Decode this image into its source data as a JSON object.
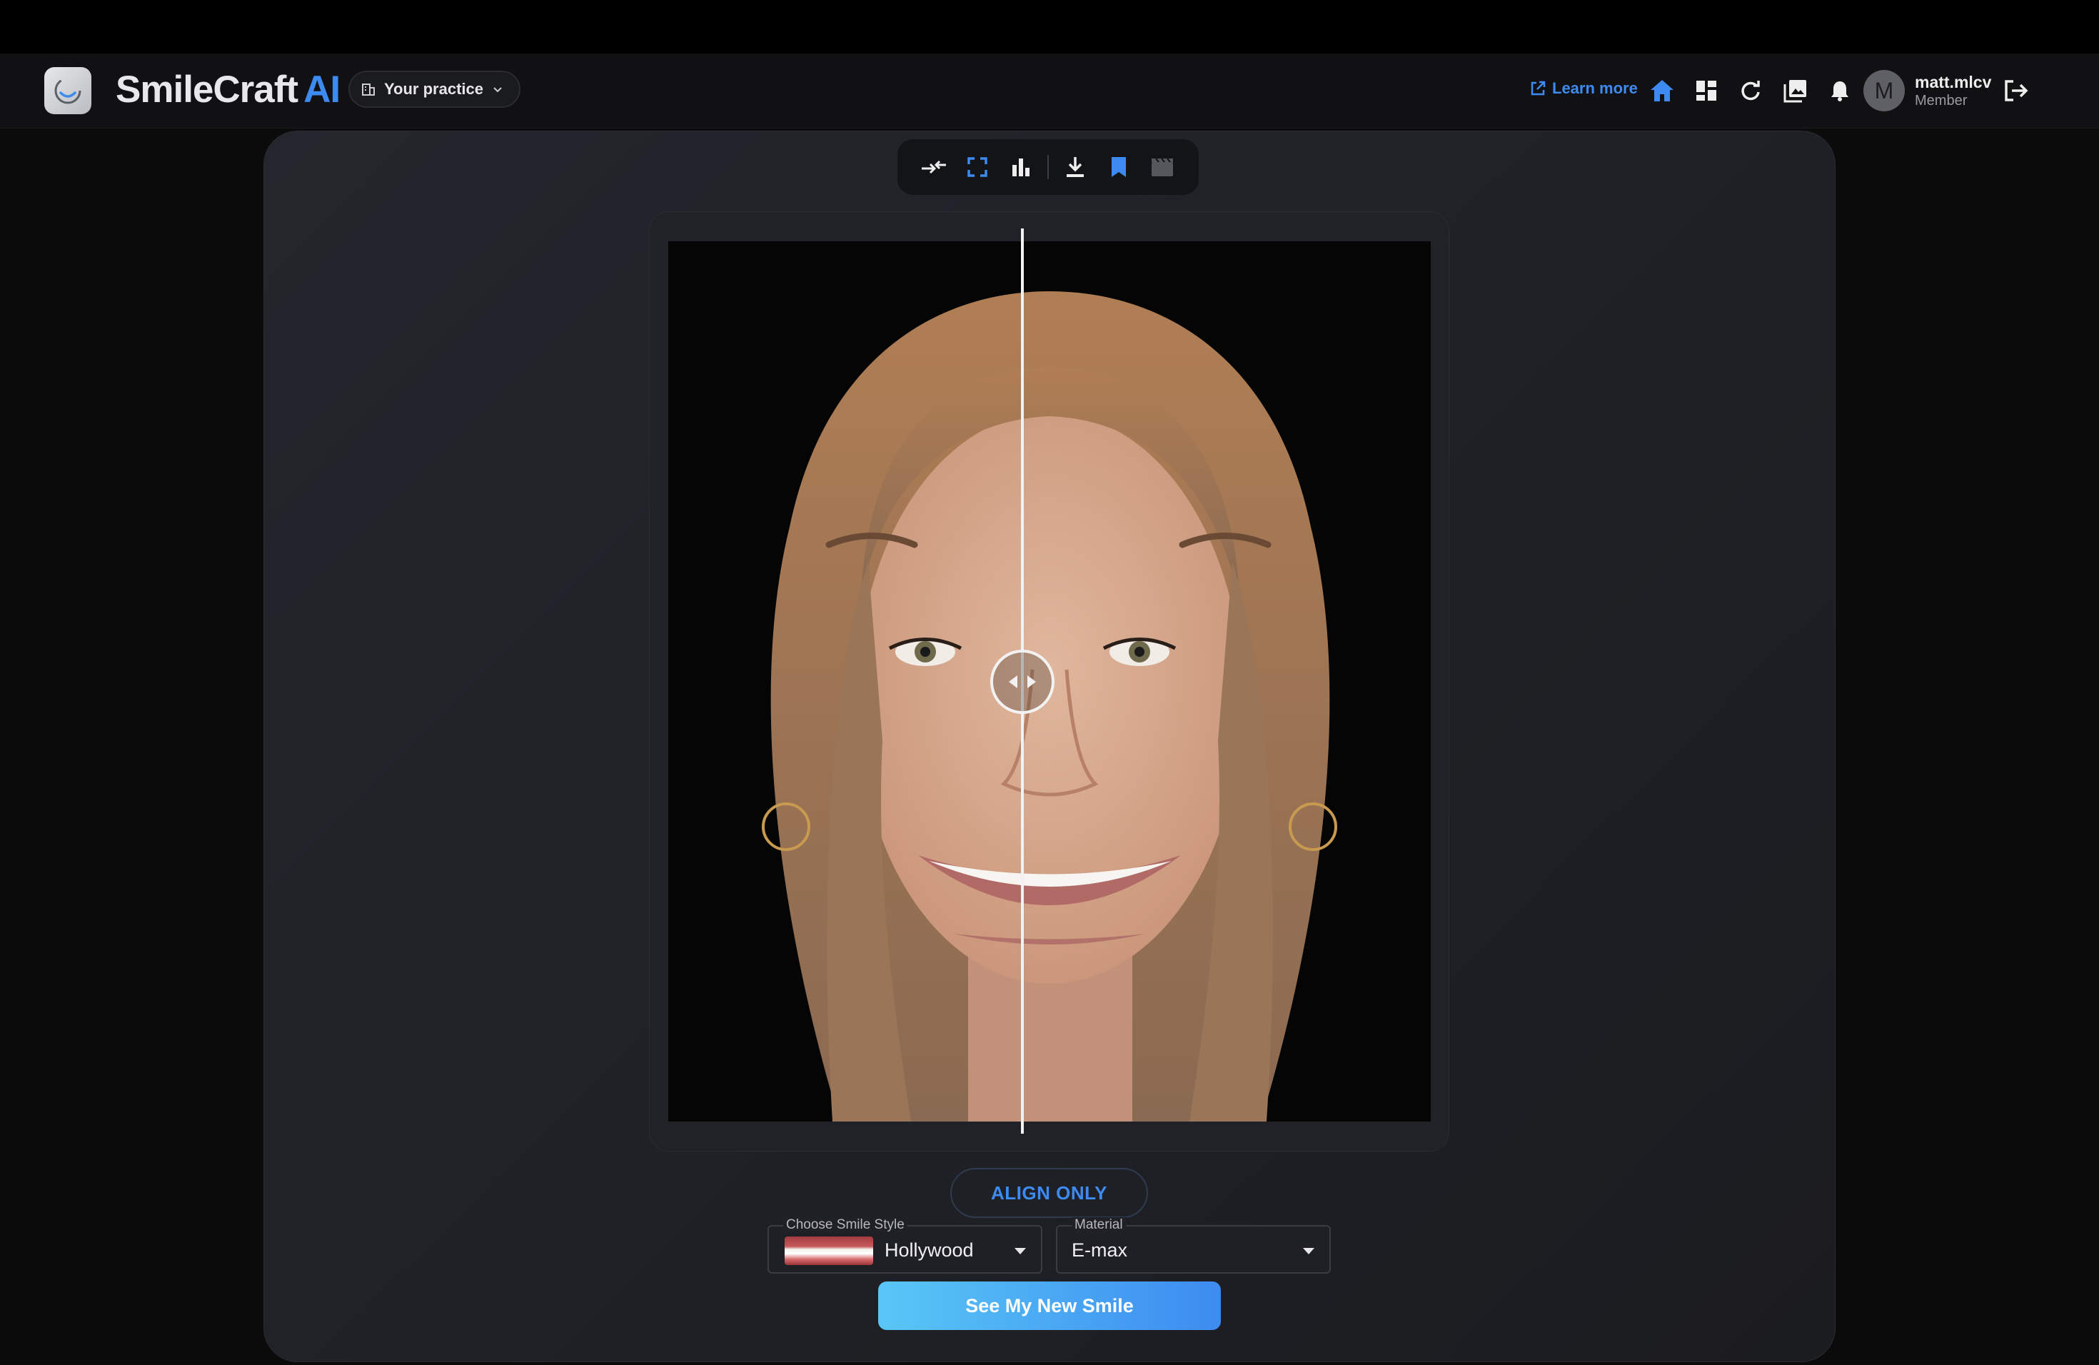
{
  "app": {
    "brand_main": "SmileCraft",
    "brand_accent": "AI",
    "accent_color": "#3d8bf0"
  },
  "header": {
    "practice_label": "Your practice",
    "learn_more": "Learn more",
    "user": {
      "name": "matt.mlcv",
      "role": "Member",
      "initial": "M"
    },
    "icons": [
      "external-link-icon",
      "home-icon",
      "dashboard-icon",
      "refresh-icon",
      "gallery-icon",
      "bell-icon",
      "logout-icon"
    ]
  },
  "toolbar": {
    "icons": [
      "compare-icon",
      "fullscreen-icon",
      "bar-chart-icon",
      "download-icon",
      "bookmark-icon",
      "video-icon"
    ]
  },
  "viewer": {
    "split_position": 0.465
  },
  "controls": {
    "align_label": "ALIGN ONLY",
    "smile_style": {
      "label": "Choose Smile Style",
      "value": "Hollywood"
    },
    "material": {
      "label": "Material",
      "value": "E-max"
    },
    "cta_label": "See My New Smile"
  }
}
